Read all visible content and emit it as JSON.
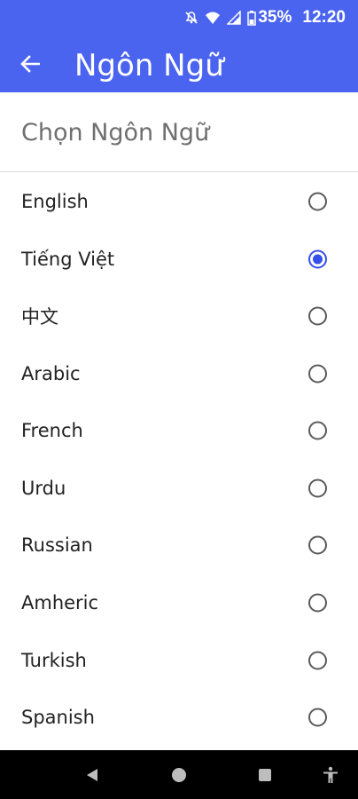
{
  "status_bar": {
    "battery": "35%",
    "time": "12:20",
    "icons": [
      "mute-bell-icon",
      "wifi-icon",
      "signal-icon",
      "battery-icon"
    ]
  },
  "app_bar": {
    "title": "Ngôn Ngữ",
    "back_icon": "arrow-left-icon",
    "color": "#4a64f0"
  },
  "section": {
    "title": "Chọn Ngôn Ngữ"
  },
  "languages": [
    {
      "label": "English",
      "selected": false
    },
    {
      "label": "Tiếng Việt",
      "selected": true
    },
    {
      "label": "中文",
      "selected": false
    },
    {
      "label": "Arabic",
      "selected": false
    },
    {
      "label": "French",
      "selected": false
    },
    {
      "label": "Urdu",
      "selected": false
    },
    {
      "label": "Russian",
      "selected": false
    },
    {
      "label": "Amheric",
      "selected": false
    },
    {
      "label": "Turkish",
      "selected": false
    },
    {
      "label": "Spanish",
      "selected": false
    }
  ],
  "nav_bar": {
    "buttons": [
      "back-triangle-icon",
      "home-circle-icon",
      "recents-square-icon",
      "accessibility-icon"
    ]
  },
  "accent_color": "#3550e8"
}
